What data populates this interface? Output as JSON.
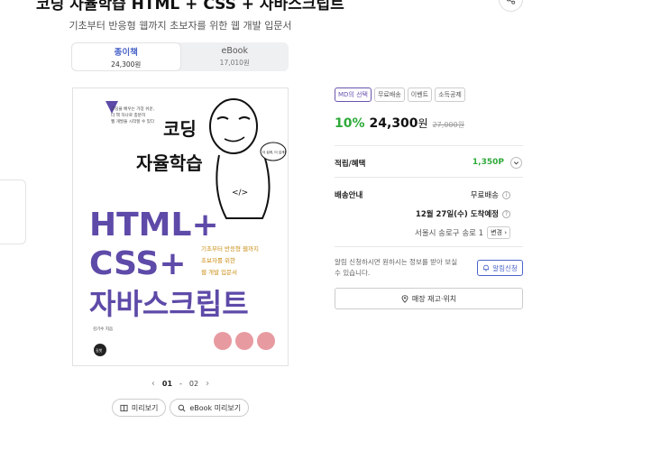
{
  "product": {
    "title": "코딩 자율학습 HTML + CSS + 자바스크립트",
    "subtitle": "기초부터 반응형 웹까지 초보자를 위한 웹 개발 입문서"
  },
  "formats": [
    {
      "label": "종이책",
      "price": "24,300원"
    },
    {
      "label": "eBook",
      "price": "17,010원"
    }
  ],
  "cover": {
    "tagline": [
      "코딩을 배우는 가장 쉬운,",
      "더 책 하나로 충분히",
      "웹 개발을 시작할 수 있다"
    ],
    "series_line1": "코딩",
    "series_line2": "자율학습",
    "title_line1": "HTML+",
    "title_line2": "CSS+",
    "title_line3": "자바스크립트",
    "bubble": "더 쉽게, 더 깊게!",
    "side_text": [
      "기초부터 반응형 웹까지",
      "초보자를 위한",
      "웹 개발 입문서"
    ],
    "author": "김기수 지음",
    "publisher": "길벗",
    "bottom_note": "유튜브 채팅\n라이브"
  },
  "pager": {
    "current": "01",
    "total": "02"
  },
  "preview": {
    "book_label": "미리보기",
    "ebook_label": "eBook 미리보기"
  },
  "badges": [
    "MD의 선택",
    "무료배송",
    "이벤트",
    "소득공제"
  ],
  "pricing": {
    "discount": "10%",
    "price": "24,300",
    "won": "원",
    "original": "27,000원"
  },
  "benefits": {
    "label": "적립/혜택",
    "points": "1,350P"
  },
  "shipping": {
    "label": "배송안내",
    "type": "무료배송",
    "arrival": "12월 27일(수) 도착예정",
    "location": "서울시 송로구 송로 1",
    "change_label": "변경"
  },
  "notify": {
    "text": "알림 신청하시면 원하시는 정보를 받아 보실 수 있습니다.",
    "button": "알림신청"
  },
  "store_button": "매장 재고·위치",
  "colors": {
    "accent_green": "#2faa3a",
    "accent_blue": "#4a64c8",
    "cover_purple": "#5e4aa8",
    "cover_yellow": "#f2c94c"
  }
}
